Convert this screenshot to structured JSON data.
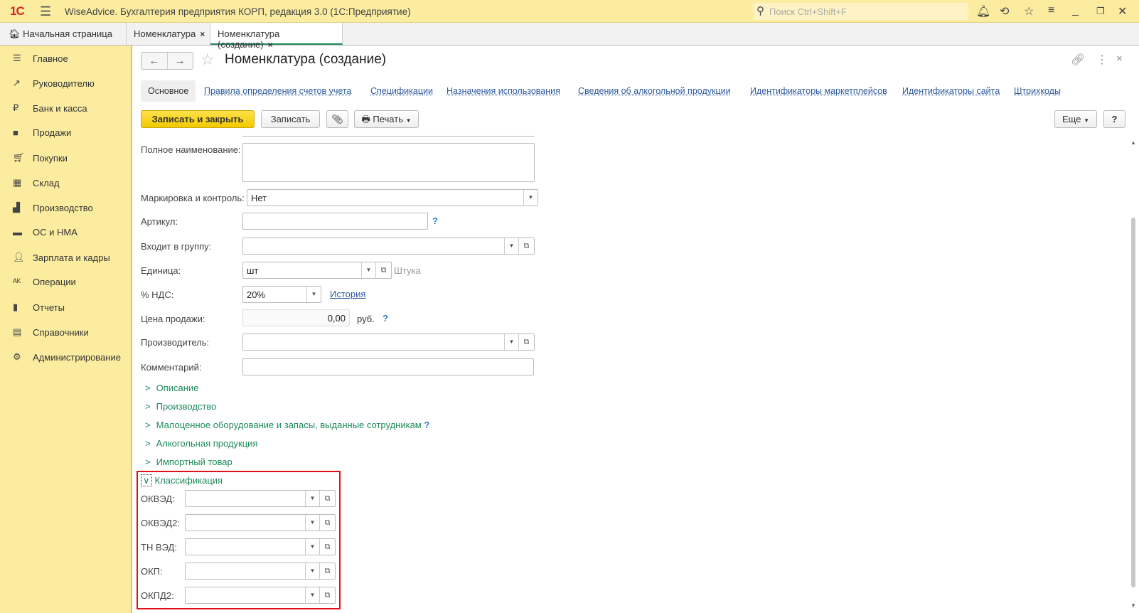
{
  "app": {
    "logo": "1С",
    "title": "WiseAdvice. Бухгалтерия предприятия КОРП, редакция 3.0  (1С:Предприятие)",
    "search_placeholder": "Поиск Ctrl+Shift+F"
  },
  "tabs": [
    {
      "label": "Начальная страница"
    },
    {
      "label": "Номенклатура"
    },
    {
      "label": "Номенклатура (создание)"
    }
  ],
  "sidebar": {
    "items": [
      {
        "label": "Главное"
      },
      {
        "label": "Руководителю"
      },
      {
        "label": "Банк и касса"
      },
      {
        "label": "Продажи"
      },
      {
        "label": "Покупки"
      },
      {
        "label": "Склад"
      },
      {
        "label": "Производство"
      },
      {
        "label": "ОС и НМА"
      },
      {
        "label": "Зарплата и кадры"
      },
      {
        "label": "Операции"
      },
      {
        "label": "Отчеты"
      },
      {
        "label": "Справочники"
      },
      {
        "label": "Администрирование"
      }
    ]
  },
  "form": {
    "title": "Номенклатура (создание)",
    "tabs": [
      "Основное",
      "Правила определения счетов учета",
      "Спецификации",
      "Назначения использования",
      "Сведения об алкогольной продукции",
      "Идентификаторы маркетплейсов",
      "Идентификаторы сайта",
      "Штрихкоды"
    ],
    "toolbar": {
      "save_close": "Записать и закрыть",
      "save": "Записать",
      "print": "Печать",
      "more": "Еще",
      "help": "?"
    },
    "fields": {
      "full_name": {
        "label": "Полное наименование:",
        "value": ""
      },
      "marking": {
        "label": "Маркировка и контроль:",
        "value": "Нет"
      },
      "article": {
        "label": "Артикул:",
        "value": "",
        "hint": "?"
      },
      "group": {
        "label": "Входит в группу:",
        "value": ""
      },
      "unit": {
        "label": "Единица:",
        "value": "шт",
        "note": "Штука"
      },
      "vat": {
        "label": "% НДС:",
        "value": "20%",
        "link": "История"
      },
      "price": {
        "label": "Цена продажи:",
        "value": "0,00",
        "currency": "руб.",
        "hint": "?"
      },
      "manufacturer": {
        "label": "Производитель:",
        "value": ""
      },
      "comment": {
        "label": "Комментарий:",
        "value": ""
      }
    },
    "groups": [
      "Описание",
      "Производство",
      "Малоценное оборудование и запасы, выданные сотрудникам",
      "Алкогольная продукция",
      "Импортный товар"
    ],
    "groups_hint": "?",
    "classification": {
      "title": "Классификация",
      "fields": [
        {
          "label": "ОКВЭД:"
        },
        {
          "label": "ОКВЭД2:"
        },
        {
          "label": "ТН ВЭД:"
        },
        {
          "label": "ОКП:"
        },
        {
          "label": "ОКПД2:"
        }
      ]
    }
  }
}
